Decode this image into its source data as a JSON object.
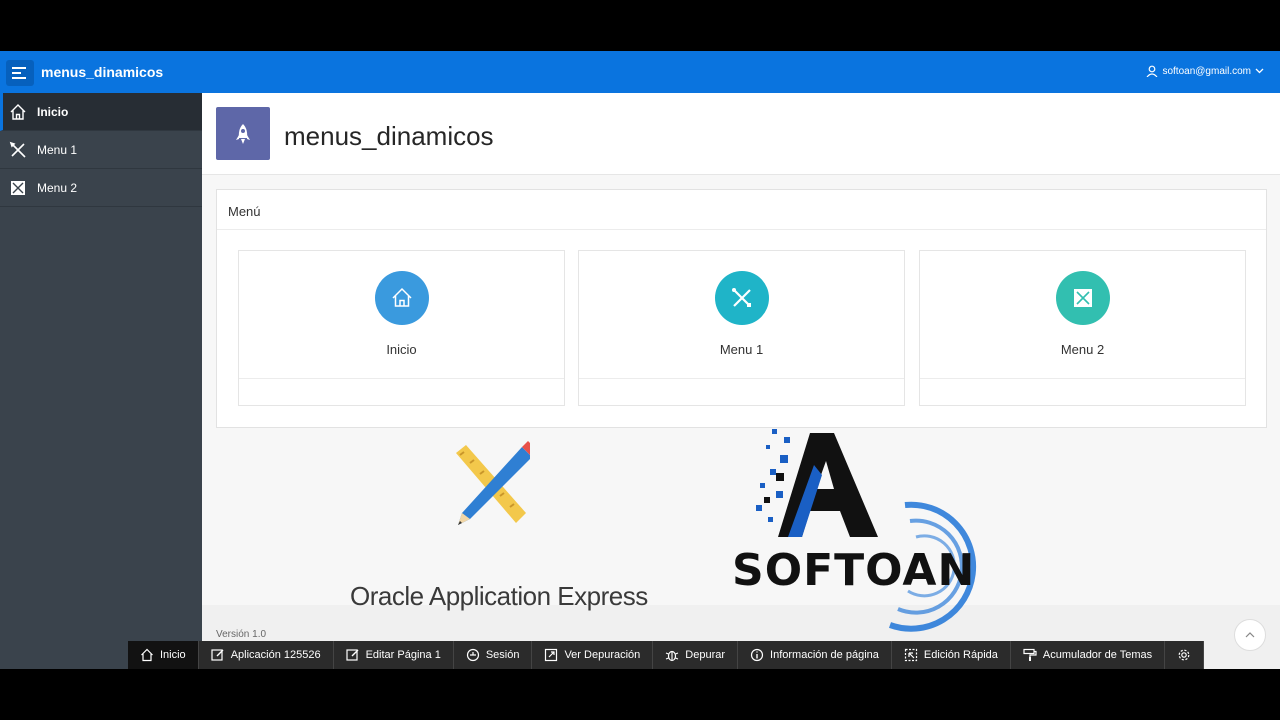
{
  "header": {
    "app_title": "menus_dinamicos",
    "user": "softoan@gmail.com"
  },
  "sidebar": {
    "items": [
      {
        "label": "Inicio",
        "icon": "home-icon"
      },
      {
        "label": "Menu 1",
        "icon": "tools-icon"
      },
      {
        "label": "Menu 2",
        "icon": "pattern-icon"
      }
    ]
  },
  "hero": {
    "title": "menus_dinamicos",
    "icon": "rocket-icon"
  },
  "region": {
    "title": "Menú"
  },
  "cards": [
    {
      "label": "Inicio",
      "icon": "home-icon",
      "color": "#3a9ade"
    },
    {
      "label": "Menu 1",
      "icon": "tools-icon",
      "color": "#1fb4c8"
    },
    {
      "label": "Menu 2",
      "icon": "pattern-icon",
      "color": "#32bfb0"
    }
  ],
  "footer": {
    "version": "Versión 1.0"
  },
  "overlay": {
    "apex_text": "Oracle Application Express",
    "brand_text": "SOFTOAN"
  },
  "devbar": {
    "items": [
      {
        "label": "Inicio",
        "icon": "home-icon"
      },
      {
        "label": "Aplicación 125526",
        "icon": "edit-icon"
      },
      {
        "label": "Editar Página 1",
        "icon": "edit-icon"
      },
      {
        "label": "Sesión",
        "icon": "session-icon"
      },
      {
        "label": "Ver Depuración",
        "icon": "external-icon"
      },
      {
        "label": "Depurar",
        "icon": "bug-icon"
      },
      {
        "label": "Información de página",
        "icon": "info-icon"
      },
      {
        "label": "Edición Rápida",
        "icon": "quick-edit-icon"
      },
      {
        "label": "Acumulador de Temas",
        "icon": "paint-roller-icon"
      },
      {
        "label": "",
        "icon": "gear-icon"
      }
    ]
  },
  "colors": {
    "header": "#0a74df",
    "sidebar": "#3a434c",
    "hero_icon": "#5e67a8"
  }
}
